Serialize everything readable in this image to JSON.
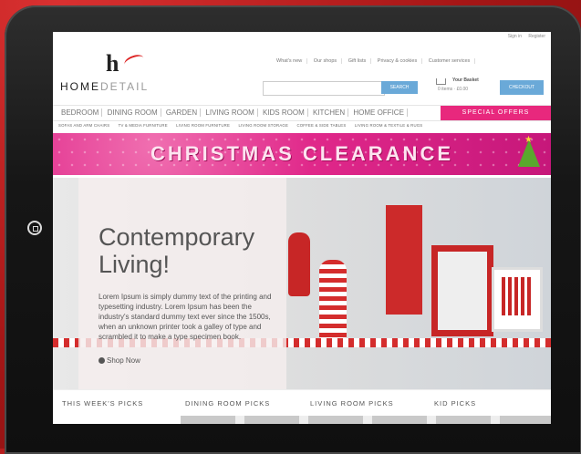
{
  "site": {
    "logo_text_bold": "HOME",
    "logo_text_light": "DETAIL",
    "top_links": [
      "Sign in",
      "Register"
    ],
    "header_links": [
      "What's new",
      "Our shops",
      "Gift lists",
      "Privacy & cookies",
      "Customer services"
    ],
    "search": {
      "placeholder": "",
      "button_label": "SEARCH"
    },
    "basket": {
      "title": "Your Basket",
      "items": "0 items",
      "total": "£0.00",
      "checkout_label": "CHECKOUT"
    }
  },
  "nav": {
    "main_items": [
      "BEDROOM",
      "DINING ROOM",
      "GARDEN",
      "LIVING ROOM",
      "KIDS ROOM",
      "KITCHEN",
      "HOME OFFICE"
    ],
    "special_label": "SPECIAL OFFERS",
    "sub_items": [
      "SOFAS AND ARM CHAIRS",
      "TV & MEDIA FURNITURE",
      "LIVING ROOM FURNITURE",
      "LIVING ROOM STORAGE",
      "COFFEE & SIDE TABLES",
      "LIVING ROOM & TEXTILE & RUGS"
    ]
  },
  "banner": {
    "title": "CHRISTMAS CLEARANCE"
  },
  "hero": {
    "heading_line1": "Contemporary",
    "heading_line2": "Living!",
    "body": "Lorem Ipsum is simply dummy text of the printing and typesetting industry. Lorem Ipsum has been the industry's standard dummy text ever since the 1500s, when an unknown printer took a galley of type and scrambled it to make a type specimen book.",
    "cta": "Shop Now"
  },
  "picks": {
    "this_week": "THIS WEEK'S PICKS",
    "dining": "DINING ROOM PICKS",
    "living": "LIVING ROOM PICKS",
    "kid": "KID PICKS"
  }
}
